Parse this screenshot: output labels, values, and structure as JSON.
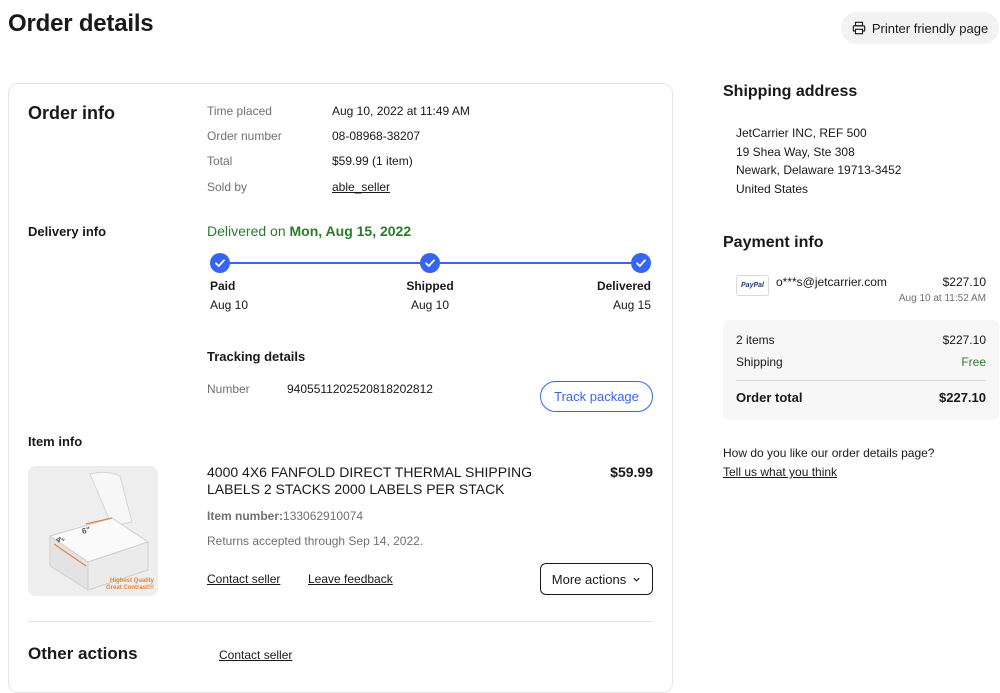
{
  "page": {
    "title": "Order details",
    "printer_label": "Printer friendly page"
  },
  "order_info": {
    "heading": "Order info",
    "rows": [
      {
        "label": "Time placed",
        "value": "Aug 10, 2022 at 11:49 AM"
      },
      {
        "label": "Order number",
        "value": "08-08968-38207"
      },
      {
        "label": "Total",
        "value": "$59.99 (1 item)"
      },
      {
        "label": "Sold by",
        "value": "able_seller"
      }
    ]
  },
  "delivery_info": {
    "heading": "Delivery info",
    "status_prefix": "Delivered on",
    "status_date": "Mon, Aug 15, 2022",
    "steps": [
      {
        "name": "Paid",
        "date": "Aug 10"
      },
      {
        "name": "Shipped",
        "date": "Aug 10"
      },
      {
        "name": "Delivered",
        "date": "Aug 15"
      }
    ],
    "tracking_heading": "Tracking details",
    "tracking_label": "Number",
    "tracking_number": "9405511202520818202812",
    "track_button": "Track package"
  },
  "item_info": {
    "heading": "Item info",
    "title": "4000 4X6 FANFOLD DIRECT THERMAL SHIPPING LABELS 2 STACKS 2000 LABELS PER STACK",
    "price": "$59.99",
    "item_number_label": "Item number:",
    "item_number": "133062910074",
    "returns": "Returns accepted through Sep 14, 2022.",
    "contact_seller": "Contact seller",
    "leave_feedback": "Leave feedback",
    "more_actions": "More actions",
    "thumb_text_1": "Highest Quality",
    "thumb_text_2": "Great Contrast!!!",
    "thumb_dim_w": "4\"",
    "thumb_dim_h": "6\""
  },
  "other_actions": {
    "heading": "Other actions",
    "contact_seller": "Contact seller"
  },
  "shipping_address": {
    "heading": "Shipping address",
    "lines": [
      "JetCarrier INC, REF 500",
      "19 Shea Way, Ste 308",
      "Newark, Delaware 19713-3452",
      "United States"
    ]
  },
  "payment_info": {
    "heading": "Payment info",
    "method_logo": "PayPal",
    "email": "o***s@jetcarrier.com",
    "amount": "$227.10",
    "date": "Aug 10 at 11:52 AM",
    "summary": [
      {
        "label": "2 items",
        "value": "$227.10"
      },
      {
        "label": "Shipping",
        "value": "Free"
      }
    ],
    "total_label": "Order total",
    "total_value": "$227.10"
  },
  "feedback": {
    "question": "How do you like our order details page?",
    "link": "Tell us what you think"
  },
  "colors": {
    "accent": "#3665f3",
    "success": "#2b7a2b",
    "text": "#191919",
    "muted": "#707070"
  }
}
